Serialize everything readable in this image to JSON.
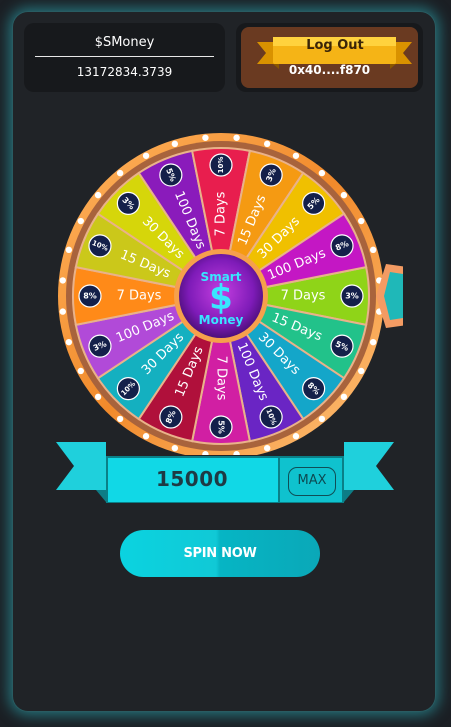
{
  "balance": {
    "token_name": "$SMoney",
    "amount": "13172834.3739"
  },
  "wallet": {
    "logout_label": "Log Out",
    "address": "0x40....f870"
  },
  "wheel": {
    "center_line1": "Smart",
    "center_line2": "Money",
    "segments": [
      {
        "label": "7 Days",
        "badge": "3%"
      },
      {
        "label": "15 Days",
        "badge": "5%"
      },
      {
        "label": "30 Days",
        "badge": "8%"
      },
      {
        "label": "100 Days",
        "badge": "10%"
      },
      {
        "label": "7 Days",
        "badge": "5%"
      },
      {
        "label": "15 Days",
        "badge": "8%"
      },
      {
        "label": "30 Days",
        "badge": "10%"
      },
      {
        "label": "100 Days",
        "badge": "3%"
      },
      {
        "label": "7 Days",
        "badge": "8%"
      },
      {
        "label": "15 Days",
        "badge": "10%"
      },
      {
        "label": "30 Days",
        "badge": "3%"
      },
      {
        "label": "100 Days",
        "badge": "5%"
      },
      {
        "label": "7 Days",
        "badge": "10%"
      },
      {
        "label": "15 Days",
        "badge": "3%"
      },
      {
        "label": "30 Days",
        "badge": "5%"
      },
      {
        "label": "100 Days",
        "badge": "8%"
      }
    ]
  },
  "bet": {
    "amount": "15000",
    "max_label": "MAX"
  },
  "spin": {
    "label": "SPIN NOW"
  },
  "colors": {
    "accent": "#0bd3e0",
    "background": "#202327",
    "wallet_brown": "#6a3a21",
    "ribbon_yellow": "#f5b416",
    "segments": [
      "#8fd418",
      "#22c28a",
      "#14a6c9",
      "#6a25c4",
      "#d11fa3",
      "#b0103b",
      "#14b0c0",
      "#b14ad8",
      "#ff8a18",
      "#cbc81a",
      "#d6d60a",
      "#8a1bbb",
      "#e81e4e",
      "#f59a12",
      "#f0c000",
      "#c417c4"
    ]
  }
}
